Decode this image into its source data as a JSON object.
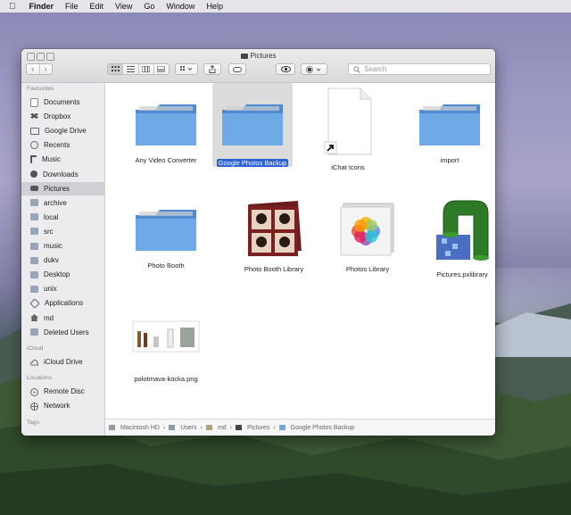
{
  "menubar": {
    "apple": "",
    "app": "Finder",
    "items": [
      "File",
      "Edit",
      "View",
      "Go",
      "Window",
      "Help"
    ]
  },
  "window": {
    "title": "Pictures",
    "search_placeholder": "Search",
    "back_glyph": "‹",
    "forward_glyph": "›"
  },
  "sidebar": {
    "favourites_label": "Favourites",
    "favourites": [
      "Documents",
      "Dropbox",
      "Google Drive",
      "Recents",
      "Music",
      "Downloads",
      "Pictures",
      "archive",
      "local",
      "src",
      "music",
      "dukv",
      "Desktop",
      "unix",
      "Applications",
      "md",
      "Deleted Users"
    ],
    "selected": "Pictures",
    "icloud_label": "iCloud",
    "icloud": [
      "iCloud Drive"
    ],
    "locations_label": "Locations",
    "locations": [
      "Remote Disc",
      "Network"
    ],
    "tags_label": "Tags"
  },
  "files": [
    {
      "name": "Any Video Converter",
      "kind": "folder"
    },
    {
      "name": "Google Photos Backup",
      "kind": "folder",
      "selected": true
    },
    {
      "name": "iChat Icons",
      "kind": "alias"
    },
    {
      "name": "import",
      "kind": "folder"
    },
    {
      "name": "Photo Booth",
      "kind": "folder"
    },
    {
      "name": "Photo Booth Library",
      "kind": "photobooth"
    },
    {
      "name": "Photos Library",
      "kind": "photos"
    },
    {
      "name": "Pictures.pxlibrary",
      "kind": "pipe"
    },
    {
      "name": "polotmava-kocka.png",
      "kind": "image"
    }
  ],
  "pathbar": [
    "Macintosh HD",
    "Users",
    "md",
    "Pictures",
    "Google Photos Backup"
  ],
  "colors": {
    "accent": "#2c63d0",
    "folder": "#6fa9e6"
  }
}
